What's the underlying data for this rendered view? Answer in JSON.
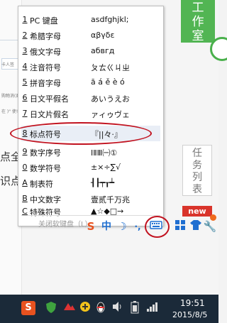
{
  "right_tabs": {
    "workspace": "工\n作\n室",
    "task_list": "任\n务\n列\n表",
    "new_badge": "new"
  },
  "left_panel": {
    "snippets": [
      "卡人签",
      "购物消(商品",
      "在 )\" 使!"
    ],
    "chars": [
      "点全",
      "识点"
    ]
  },
  "menu": {
    "items": [
      {
        "key": "1",
        "name": "PC 键盘",
        "sample": "asdfghjkl;"
      },
      {
        "key": "2",
        "name": "希腊字母",
        "sample": "αβγδε"
      },
      {
        "key": "3",
        "name": "俄文字母",
        "sample": "абвгд"
      },
      {
        "key": "4",
        "name": "注音符号",
        "sample": "ㄆㄊㄍㄐㄓ"
      },
      {
        "key": "5",
        "name": "拼音字母",
        "sample": "ā á ě è ó"
      },
      {
        "key": "6",
        "name": "日文平假名",
        "sample": "あいうえお"
      },
      {
        "key": "7",
        "name": "日文片假名",
        "sample": "ァィゥヴェ"
      },
      {
        "key": "8",
        "name": "标点符号",
        "sample": "『||々·』"
      },
      {
        "key": "9",
        "name": "数字序号",
        "sample": "ⅠⅡⅢ㈠①"
      },
      {
        "key": "0",
        "name": "数学符号",
        "sample": "±×÷∑√"
      },
      {
        "key": "A",
        "name": "制表符",
        "sample": "┨┠┯┰┷"
      },
      {
        "key": "B",
        "name": "中文数字",
        "sample": "壹贰千万兆"
      },
      {
        "key": "C",
        "name": "特殊符号",
        "sample": "▲☆◆□→"
      }
    ],
    "close_label": "关闭软键盘（L）"
  },
  "ime_bar": {
    "icons": [
      "sogou-s-icon",
      "chinese-mode-icon",
      "moon-icon",
      "punctuation-icon",
      "soft-keyboard-icon",
      "skin-icon",
      "shirt-icon",
      "wrench-icon"
    ],
    "labels": {
      "chinese": "中",
      "punct": "·,"
    }
  },
  "taskbar": {
    "time": "19:51",
    "date": "2015/8/5"
  },
  "colors": {
    "green_tab": "#52b553",
    "highlight_red": "#c1121f",
    "new_badge": "#d9342b",
    "taskbar": "#1b2a39",
    "selected_item": "#e9eef6"
  }
}
